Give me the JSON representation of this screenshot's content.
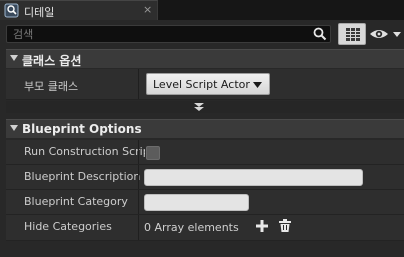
{
  "tab": {
    "title": "디테일",
    "close": "×"
  },
  "search": {
    "placeholder": "검색",
    "value": ""
  },
  "sections": {
    "class_options": {
      "title": "클래스 옵션",
      "parent_class_label": "부모 클래스",
      "parent_class_value": "Level Script Actor"
    },
    "blueprint_options": {
      "title": "Blueprint Options",
      "run_construction_label": "Run Construction Script",
      "run_construction_checked": false,
      "description_label": "Blueprint Description",
      "description_value": "",
      "category_label": "Blueprint Category",
      "category_value": "",
      "hide_categories_label": "Hide Categories",
      "hide_categories_value": "0 Array elements"
    }
  },
  "icons": {
    "tab": "details-magnifier-icon",
    "search": "search-icon",
    "view_options": "grid-view-icon",
    "visibility": "eye-icon",
    "add": "add-icon",
    "delete": "trash-icon"
  },
  "colors": {
    "panel_bg": "#282828",
    "header_bg": "#3a3a3a",
    "dropdown_bg": "#e0e0e0"
  }
}
